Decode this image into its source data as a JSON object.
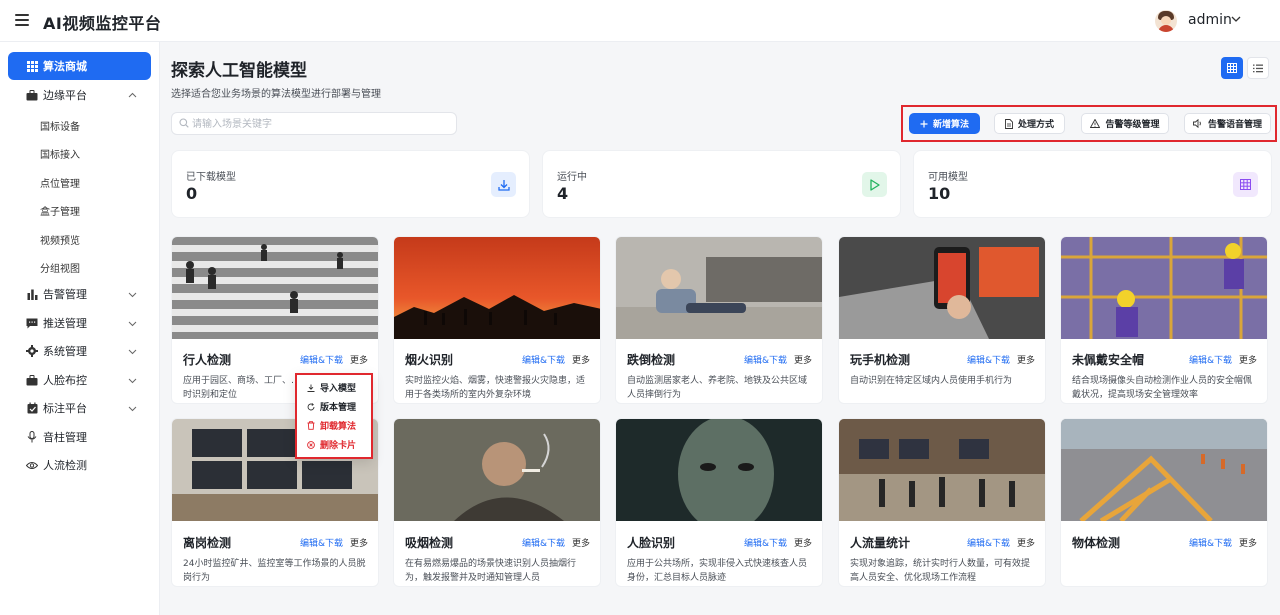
{
  "app": {
    "title": "AI视频监控平台",
    "username": "admin"
  },
  "sidebar": {
    "items": [
      {
        "label": "算法商城"
      },
      {
        "label": "边缘平台"
      },
      {
        "label": "告警管理"
      },
      {
        "label": "推送管理"
      },
      {
        "label": "系统管理"
      },
      {
        "label": "人脸布控"
      },
      {
        "label": "标注平台"
      },
      {
        "label": "音柱管理"
      },
      {
        "label": "人流检测"
      }
    ],
    "sub_items": [
      "国标设备",
      "国标接入",
      "点位管理",
      "盒子管理",
      "视频预览",
      "分组视图"
    ]
  },
  "page": {
    "title": "探索人工智能模型",
    "subtitle": "选择适合您业务场景的算法模型进行部署与管理"
  },
  "search": {
    "placeholder": "请输入场景关键字"
  },
  "actions": [
    "新增算法",
    "处理方式",
    "告警等级管理",
    "告警语音管理"
  ],
  "stats": [
    {
      "label": "已下载模型",
      "value": "0",
      "icon": "download-icon",
      "color": "#1f6bf2"
    },
    {
      "label": "运行中",
      "value": "4",
      "icon": "play-icon",
      "color": "#22b35e"
    },
    {
      "label": "可用模型",
      "value": "10",
      "icon": "grid-icon",
      "color": "#8b4cf0"
    }
  ],
  "cards": [
    {
      "title": "行人检测",
      "edit": "编辑&下载",
      "more": "更多",
      "desc": "应用于园区、商场、工厂、……现对行人的实时识别和定位"
    },
    {
      "title": "烟火识别",
      "edit": "编辑&下载",
      "more": "更多",
      "desc": "实时监控火焰、烟雾，快速警报火灾隐患，适用于各类场所的室内外复杂环境"
    },
    {
      "title": "跌倒检测",
      "edit": "编辑&下载",
      "more": "更多",
      "desc": "自动监测居家老人、养老院、地铁及公共区域人员摔倒行为"
    },
    {
      "title": "玩手机检测",
      "edit": "编辑&下载",
      "more": "更多",
      "desc": "自动识别在特定区域内人员使用手机行为"
    },
    {
      "title": "未佩戴安全帽",
      "edit": "编辑&下载",
      "more": "更多",
      "desc": "结合现场摄像头自动检测作业人员的安全帽佩戴状况，提高现场安全管理效率"
    },
    {
      "title": "离岗检测",
      "edit": "编辑&下载",
      "more": "更多",
      "desc": "24小时监控矿井、监控室等工作场景的人员脱岗行为"
    },
    {
      "title": "吸烟检测",
      "edit": "编辑&下载",
      "more": "更多",
      "desc": "在有易燃易爆品的场景快速识别人员抽烟行为，触发报警并及时通知管理人员"
    },
    {
      "title": "人脸识别",
      "edit": "编辑&下载",
      "more": "更多",
      "desc": "应用于公共场所，实现非侵入式快速核查人员身份，汇总目标人员脉迹"
    },
    {
      "title": "人流量统计",
      "edit": "编辑&下载",
      "more": "更多",
      "desc": "实现对象追踪，统计实时行人数量，可有效提高人员安全、优化现场工作流程"
    },
    {
      "title": "物体检测",
      "edit": "编辑&下载",
      "more": "更多",
      "desc": ""
    }
  ],
  "dropdown": [
    "导入模型",
    "版本管理",
    "卸载算法",
    "删除卡片"
  ],
  "colors": {
    "accent": "#1f6bf2",
    "danger": "#e0282e"
  }
}
